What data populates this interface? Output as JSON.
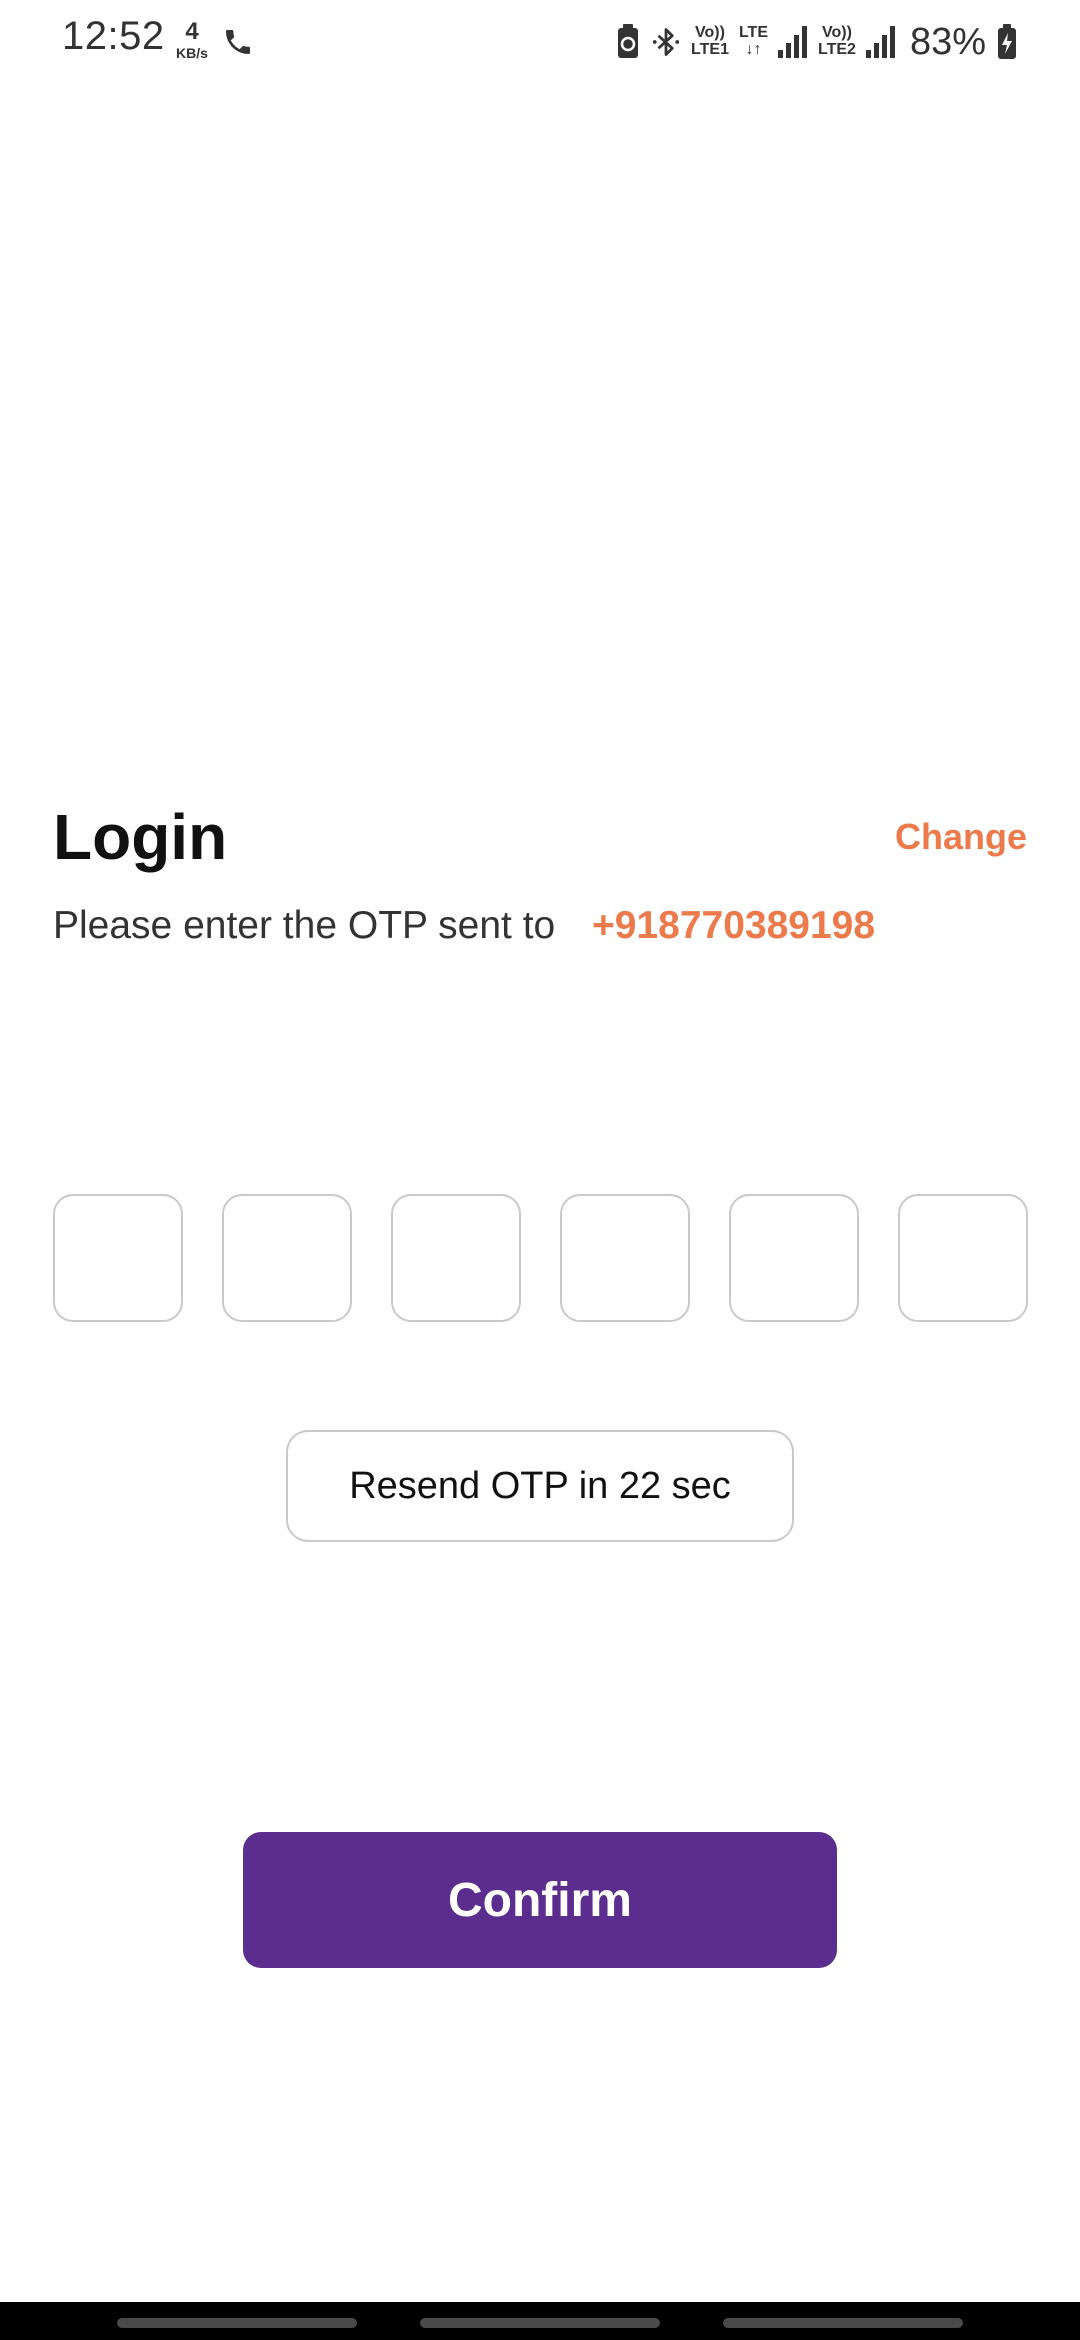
{
  "status_bar": {
    "time": "12:52",
    "speed_value": "4",
    "speed_unit": "KB/s",
    "sim1_label_top": "Vo))",
    "sim1_label_bottom": "LTE1",
    "data_label_top": "LTE",
    "data_label_bottom": "↓↑",
    "sim2_label_top": "Vo))",
    "sim2_label_bottom": "LTE2",
    "battery": "83%",
    "icons": [
      "phone-call-icon",
      "battery-saver-icon",
      "bluetooth-icon",
      "signal-icon",
      "battery-charging-icon"
    ]
  },
  "login": {
    "title": "Login",
    "change_label": "Change",
    "subtitle": "Please enter the OTP sent to",
    "phone": "+918770389198"
  },
  "otp": {
    "digits": [
      "",
      "",
      "",
      "",
      "",
      ""
    ]
  },
  "resend": {
    "label": "Resend OTP in 22 sec"
  },
  "confirm": {
    "label": "Confirm"
  },
  "colors": {
    "accent_orange": "#ec7a4b",
    "primary_purple": "#5b2d8e",
    "box_border": "#c9c9c9",
    "text_dark": "#111111"
  }
}
